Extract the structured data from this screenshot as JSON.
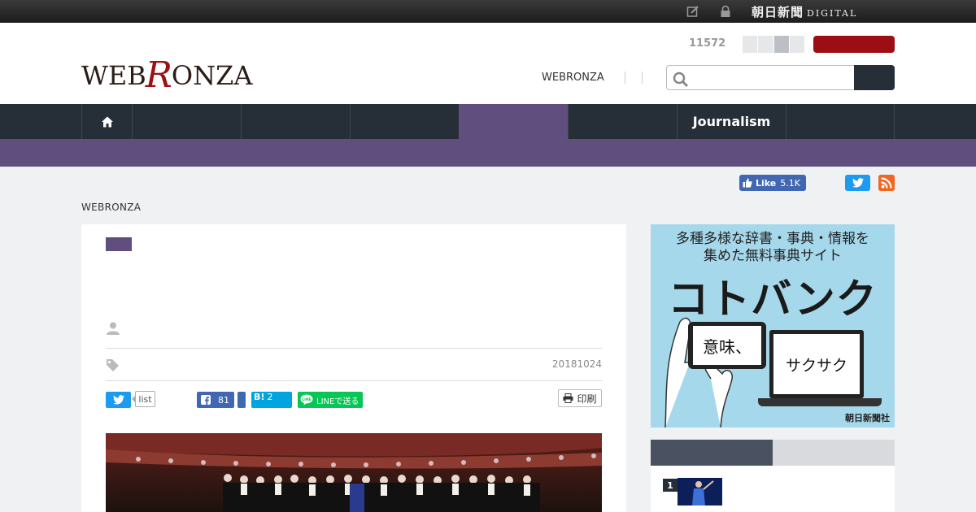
{
  "topbar": {
    "brand": "朝日新聞",
    "brand_sub": "DIGITAL",
    "icons": [
      "edit-icon",
      "lock-icon"
    ]
  },
  "header": {
    "logo_pre": "WEB",
    "logo_r": "R",
    "logo_post": "ONZA",
    "count": "11572",
    "link": "WEBRONZA"
  },
  "nav": {
    "home_icon": "home-icon",
    "active_label": "Journalism"
  },
  "social": {
    "like_label": "Like",
    "like_count": "5.1K"
  },
  "breadcrumb": "WEBRONZA",
  "article": {
    "date": "20181024",
    "list_label": "list",
    "fb_count": "81",
    "hatena_label": "B!",
    "hatena_count": "2",
    "line_label": "LINEで送る",
    "print_label": "印刷"
  },
  "ad": {
    "line1": "多種多様な辞書・事典・情報を",
    "line2": "集めた無料事典サイト",
    "title": "コトバンク",
    "phone_text": "意味、",
    "laptop_text": "サクサク",
    "maker": "朝日新聞社"
  },
  "ranking": {
    "first_rank": "1"
  }
}
